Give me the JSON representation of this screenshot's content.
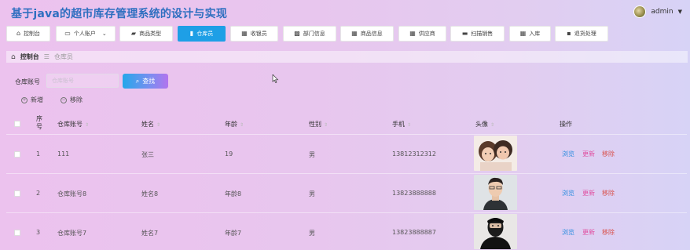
{
  "app": {
    "title": "基于java的超市库存管理系统的设计与实现"
  },
  "user": {
    "name": "admin"
  },
  "nav": [
    {
      "label": "控制台",
      "icon": "home-icon",
      "glyph": "⌂"
    },
    {
      "label": "个人账户",
      "icon": "id-card-icon",
      "glyph": "▭",
      "has_dropdown": true
    },
    {
      "label": "商品类型",
      "icon": "truck-icon",
      "glyph": "▰"
    },
    {
      "label": "仓库员",
      "icon": "chart-icon",
      "glyph": "▮",
      "active": true
    },
    {
      "label": "收银员",
      "icon": "grid-icon",
      "glyph": "▦"
    },
    {
      "label": "部门信息",
      "icon": "grid-dots-icon",
      "glyph": "▩"
    },
    {
      "label": "商品信息",
      "icon": "grid-icon",
      "glyph": "▦"
    },
    {
      "label": "供应商",
      "icon": "grid-icon",
      "glyph": "▦"
    },
    {
      "label": "扫描销售",
      "icon": "briefcase-icon",
      "glyph": "▬"
    },
    {
      "label": "入库",
      "icon": "grid-icon",
      "glyph": "▦"
    },
    {
      "label": "退货处理",
      "icon": "message-icon",
      "glyph": "▪"
    }
  ],
  "breadcrumb": {
    "home": "控制台",
    "current": "仓库员",
    "separator": "☰"
  },
  "search": {
    "label": "仓库账号",
    "placeholder": "仓库账号",
    "button": "查找"
  },
  "actions": {
    "add": "新增",
    "remove": "移除"
  },
  "table": {
    "headers": {
      "index": "序号",
      "account": "仓库账号",
      "name": "姓名",
      "age": "年龄",
      "gender": "性别",
      "phone": "手机",
      "avatar": "头像",
      "ops": "操作"
    },
    "rows": [
      {
        "index": "1",
        "account": "111",
        "name": "张三",
        "age": "19",
        "gender": "男",
        "phone": "13812312312",
        "photo": "photo-two-children"
      },
      {
        "index": "2",
        "account": "仓库账号8",
        "name": "姓名8",
        "age": "年龄8",
        "gender": "男",
        "phone": "13823888888",
        "photo": "photo-young-man"
      },
      {
        "index": "3",
        "account": "仓库账号7",
        "name": "姓名7",
        "age": "年龄7",
        "gender": "男",
        "phone": "13823888887",
        "photo": "photo-masked-man"
      }
    ],
    "op_labels": {
      "view": "浏览",
      "edit": "更新",
      "remove": "移除"
    }
  },
  "colors": {
    "title": "#2e6fc0",
    "active_nav": "#1e9fe6",
    "link_view": "#2f8ee0",
    "link_edit": "#e04fa0",
    "link_remove": "#d9534f"
  }
}
